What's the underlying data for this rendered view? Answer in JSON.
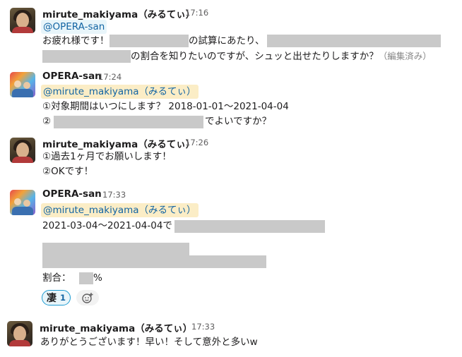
{
  "messages": [
    {
      "user": "mirute_makiyama（みるてぃ）",
      "time": "17:16",
      "mention": "@OPERA-san",
      "line1_a": "お疲れ様です！",
      "line1_b": "の試算にあたり、",
      "line2_b": "の割合を知りたいのですが、シュッと出せたりしますか？",
      "edited": "（編集済み）"
    },
    {
      "user": "OPERA-san",
      "time": "17:24",
      "mention": "@mirute_makiyama（みるてぃ）",
      "line1": "①対象期間はいつにします？ 2018-01-01〜2021-04-04",
      "line2_a": "②",
      "line2_b": "でよいですか？"
    },
    {
      "user": "mirute_makiyama（みるてぃ）",
      "time": "17:26",
      "line1": "①過去1ヶ月でお願いします！",
      "line2": "②OKです！"
    },
    {
      "user": "OPERA-san",
      "time": "17:33",
      "mention": "@mirute_makiyama（みるてぃ）",
      "line1": "2021-03-04〜2021-04-04で",
      "ratio_label": "割合：",
      "ratio_suffix": "%",
      "reaction_emoji": "凄",
      "reaction_count": "1",
      "add_reaction_icon": "add-reaction-icon"
    },
    {
      "user": "mirute_makiyama（みるてぃ）",
      "time": "17:33",
      "line1": "ありがとうございます！早い！そして意外と多いw"
    }
  ]
}
